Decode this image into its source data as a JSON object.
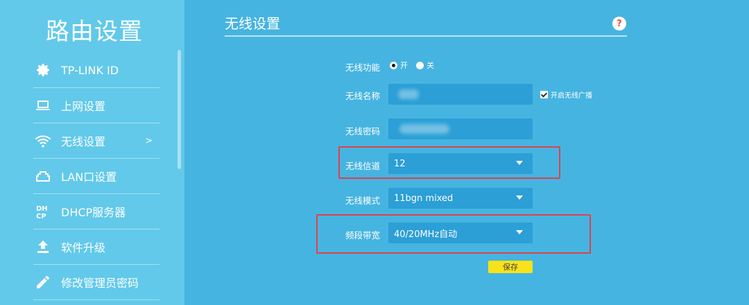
{
  "app_title": "路由设置",
  "sidebar": {
    "items": [
      {
        "label": "TP-LINK ID",
        "icon": "gear-icon"
      },
      {
        "label": "上网设置",
        "icon": "laptop-icon"
      },
      {
        "label": "无线设置",
        "icon": "wifi-icon",
        "arrow": ">"
      },
      {
        "label": "LAN口设置",
        "icon": "lan-port-icon"
      },
      {
        "label": "DHCP服务器",
        "icon": "dhcp-icon"
      },
      {
        "label": "软件升级",
        "icon": "upload-icon"
      },
      {
        "label": "修改管理员密码",
        "icon": "pencil-icon"
      }
    ]
  },
  "main": {
    "title": "无线设置",
    "help": "?",
    "wireless_function": {
      "label": "无线功能",
      "on": "开",
      "off": "关"
    },
    "ssid": {
      "label": "无线名称",
      "broadcast_label": "开启无线广播"
    },
    "password": {
      "label": "无线密码"
    },
    "channel": {
      "label": "无线信道",
      "value": "12"
    },
    "mode": {
      "label": "无线模式",
      "value": "11bgn mixed"
    },
    "bandwidth": {
      "label": "频段带宽",
      "value": "40/20MHz自动"
    },
    "save_label": "保存"
  },
  "colors": {
    "sidebar_bg": "#62c9ea",
    "main_bg": "#46b4e0",
    "field_bg": "#2b9fd6",
    "highlight": "#e3404a",
    "save_button": "#f8e21a"
  }
}
